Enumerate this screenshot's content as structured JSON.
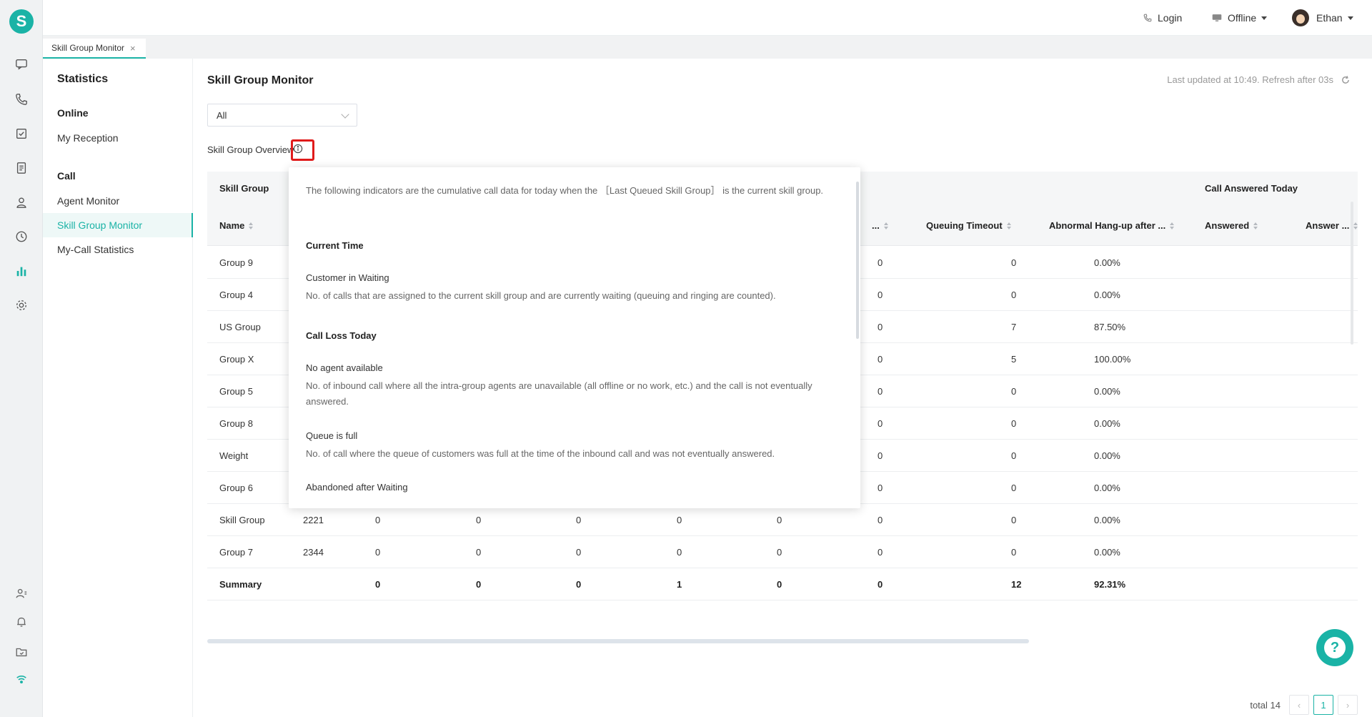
{
  "app": {
    "logo_letter": "S",
    "accent": "#1ab3a6"
  },
  "rail": {
    "icons": [
      "chat-icon",
      "phone-icon",
      "task-icon",
      "document-icon",
      "contacts-icon",
      "history-icon",
      "statistics-icon",
      "settings-icon",
      "agent-status-icon",
      "bell-icon",
      "folder-icon",
      "wifi-icon"
    ]
  },
  "topbar": {
    "login": "Login",
    "status": "Offline",
    "user": "Ethan"
  },
  "tab": {
    "label": "Skill Group Monitor",
    "close": "×"
  },
  "sidemenu": {
    "title": "Statistics",
    "online_group": "Online",
    "online_items": [
      "My Reception"
    ],
    "call_group": "Call",
    "call_items": [
      "Agent Monitor",
      "Skill Group Monitor",
      "My-Call Statistics"
    ]
  },
  "main": {
    "title": "Skill Group Monitor",
    "updated": "Last updated at 10:49. Refresh after 03s",
    "select_value": "All",
    "overview_label": "Skill Group Overview"
  },
  "table": {
    "group_header_left": "Skill Group",
    "group_header_right": "Call Answered Today",
    "columns": [
      "Name",
      "...",
      "Queuing Timeout",
      "Abnormal Hang-up after ...",
      "Answered",
      "Answer ..."
    ],
    "rows": [
      [
        "Group 9",
        "",
        "",
        "",
        "",
        "",
        "0",
        "0",
        "0",
        "0.00%"
      ],
      [
        "Group 4",
        "",
        "",
        "",
        "",
        "",
        "0",
        "0",
        "0",
        "0.00%"
      ],
      [
        "US Group",
        "",
        "",
        "",
        "",
        "",
        "0",
        "0",
        "7",
        "87.50%"
      ],
      [
        "Group X",
        "",
        "",
        "",
        "",
        "",
        "0",
        "0",
        "5",
        "100.00%"
      ],
      [
        "Group 5",
        "",
        "",
        "",
        "",
        "",
        "0",
        "0",
        "0",
        "0.00%"
      ],
      [
        "Group 8",
        "",
        "",
        "",
        "",
        "",
        "0",
        "0",
        "0",
        "0.00%"
      ],
      [
        "Weight",
        "",
        "",
        "",
        "",
        "",
        "0",
        "0",
        "0",
        "0.00%"
      ],
      [
        "Group 6",
        "2002",
        "0",
        "0",
        "0",
        "0",
        "0",
        "0",
        "0",
        "0.00%"
      ],
      [
        "Skill Group",
        "2221",
        "0",
        "0",
        "0",
        "0",
        "0",
        "0",
        "0",
        "0.00%"
      ],
      [
        "Group 7",
        "2344",
        "0",
        "0",
        "0",
        "0",
        "0",
        "0",
        "0",
        "0.00%"
      ]
    ],
    "summary": [
      "Summary",
      "",
      "0",
      "0",
      "0",
      "1",
      "0",
      "0",
      "12",
      "92.31%"
    ]
  },
  "pagination": {
    "total": "total 14",
    "prev": "‹",
    "current": "1",
    "next": "›"
  },
  "popover": {
    "intro": "The following indicators are the cumulative call data for today when the ［Last Queued Skill Group］ is the current skill group.",
    "current_time": "Current Time",
    "waiting_title": "Customer in Waiting",
    "waiting_desc": "No. of calls that are assigned to the current skill group and are currently waiting (queuing and ringing are counted).",
    "loss_title": "Call Loss Today",
    "no_agent_title": "No agent available",
    "no_agent_desc": "No. of inbound call where all the intra-group agents are unavailable (all offline or no work, etc.) and the call is not eventually answered.",
    "queue_full_title": "Queue is full",
    "queue_full_desc": "No. of call where the queue of customers was full at the time of the inbound call and was not eventually answered.",
    "abandoned_title": "Abandoned after Waiting"
  },
  "help": {
    "symbol": "?"
  }
}
